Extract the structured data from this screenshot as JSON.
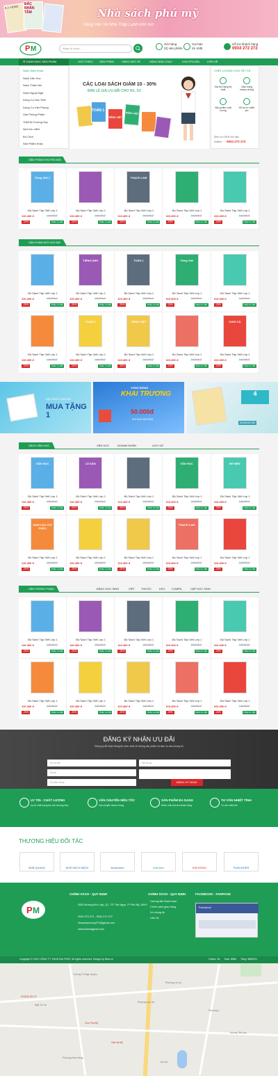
{
  "banner": {
    "title": "Nhà sách phú mỹ",
    "subtitle": "Hãng Ven Và Nhà Thập Lạnh ước mơ",
    "book1": "A.J. HOGE",
    "book2": "ĐẮC NHÂN TÂM"
  },
  "header": {
    "search_placeholder": "Nhập từ khóa...",
    "cart_label1": "Giỏ hàng",
    "cart_label2": "(0) sản phẩm",
    "call_label1": "Gọi bán",
    "call_label2": "tới nhất",
    "support_label": "Hỗ trợ khách hàng",
    "hotline": "0934 272 272"
  },
  "nav": {
    "category_label": "DANH MỤC SẢN PHẨM",
    "items": [
      "GIỚI THIỆU",
      "SẢN PHẨM",
      "HÀNG MỚI VỀ",
      "HÀNG BÁN CHẠY",
      "KHUYẾN MÃI",
      "LIÊN HỆ"
    ]
  },
  "sidebar": {
    "items": [
      "Sách Giáo Khoa",
      "Sách Văn Học",
      "Sách Thiếu Nhi",
      "Sách Ngoại Ngữ",
      "Dụng Cụ Học Sinh",
      "Dụng Cụ Văn Phòng",
      "Văn Phòng Phẩm",
      "Thiết Bị Trường Học",
      "Quà lưu niệm",
      "Đồ Chơi",
      "Sản Phẩm Khác"
    ]
  },
  "hero": {
    "line1": "CÁC LOẠI SÁCH GIẢM 10 - 30%",
    "line2": "BÁN LẺ GIÁ ƯU ĐÃI CHO HS, SV",
    "book1": "TOÁN 1",
    "book2": "TIẾNG VIỆT",
    "book3": "TIẾNG VIỆT"
  },
  "rightpanel": {
    "title": "CHẤT LƯỢNG CHO TẤT CẢ",
    "features": [
      "Giá tốt Hàng tốt nhất",
      "Giao hàng nhanh chóng",
      "Sản phẩm chất lượng",
      "Hỗ trợ tư miễn phí"
    ],
    "service_line": "Dịch vụ CSKH chu đáo",
    "hotline_label": "Hotline:",
    "hotline": "0934 272 272"
  },
  "product": {
    "name": "Bộ Sách Tập Viết Lớp 1",
    "price": "110.400 đ",
    "old_price": "149.000 đ",
    "discount": "-20%",
    "button": "Nhận ưu đãi"
  },
  "sections": {
    "promo": {
      "title": "SẢN PHẨM KHUYẾN MÃI"
    },
    "featured": {
      "title": "SẢN PHẨM MỚI NỔI BẬT"
    },
    "literature": {
      "title": "SÁCH VĂN HỌC",
      "subs": [
        "VĂN HỌC",
        "DOANH NHÂN",
        "LỊCH SỬ"
      ]
    },
    "stationery": {
      "title": "VĂN PHÒNG PHẨM",
      "subs": [
        "BẢNG HỌC SINH",
        "VIẾT",
        "THƯỚC",
        "KEO",
        "COMPA",
        "CẶP HỌC SINH"
      ]
    }
  },
  "cover_titles": {
    "promo": [
      "Tiếng Việt 1",
      "",
      "THẠCH LAM",
      "",
      ""
    ],
    "featured": [
      "",
      "TIẾNG ANH",
      "TOÁN 1",
      "Tiếng Việt",
      "",
      "",
      "TOÁN 1",
      "TIẾNG VIỆT",
      "",
      "CHƠI CẢ"
    ],
    "literature": [
      "VĂN HỌC",
      "LÃ SẢN",
      "",
      "VĂN HỌC",
      "ĐỂ MÈN",
      "NAM CAO CHÍ PHÈO",
      "",
      "",
      "THẠCH LAM",
      ""
    ]
  },
  "promo_banners": {
    "b1_text": "HỘI SÁCH QUÀ BA",
    "b1_big": "MUA TẶNG 1",
    "b2_top": "TƯNG BỪNG",
    "b2_big": "KHAI TRƯƠNG",
    "b2_amount": "50.000đ",
    "b2_note": "KHI MUA 200.000đ",
    "b3_phone": "08.66911789"
  },
  "newsletter": {
    "title": "ĐĂNG KÝ NHẬN ƯU ĐÃI",
    "desc": "Đăng ký để nhận thông tin sớm nhất về những sản phẩm và dịch vụ của chúng tôi",
    "name_placeholder": "Họ và tên",
    "phone_placeholder": "Số điện thoại",
    "email_placeholder": "Email",
    "note_placeholder": "Nội dung",
    "button": "ĐĂNG KÝ NGAY"
  },
  "features": [
    {
      "title": "UY TÍN - CHẤT LƯỢNG",
      "desc": "Uy tín chất lượng tạo nên thương hiệu"
    },
    {
      "title": "VẬN CHUYỂN SIÊU TỐC",
      "desc": "Vận chuyển nhanh chóng"
    },
    {
      "title": "SẢN PHẨM ĐA DẠNG",
      "desc": "Nhiều mẫu mã cho khách hàng"
    },
    {
      "title": "TƯ VẤN NHIỆT TÌNH",
      "desc": "Tư vấn nhiệt tình"
    }
  ],
  "partners": {
    "title": "THƯƠNG HIỆU ĐỐI TÁC",
    "logos": [
      "NHÃ QUANG",
      "NHÃ SÁCH BÁCH",
      "Bookdome",
      "nhã nam",
      "KIM ĐỒNG",
      "PUBLISHER"
    ]
  },
  "footer": {
    "col1_title": "CHÍNH SÁCH - QUY ĐỊNH",
    "address": "2050 Đường Đức Lập, Q1, TP. Tân Ngọc, P. Phú Mỹ, 08VV",
    "phone": "0934 272 272 - 0934 272 272",
    "email": "nhasachphumy272@gmail.com",
    "website": "www.kimlongphat.com",
    "col2_title": "CHÍNH SÁCH - QUY ĐỊNH",
    "col2_items": [
      "Hướng dẫn thanh toán",
      "Chính sách giao hàng",
      "Về chúng tôi",
      "Liên hệ"
    ],
    "col3_title": "FACEBOOK - FANPAGE",
    "fb_name": "Facebook"
  },
  "bottombar": {
    "copyright": "Copyright © 2021 CÔNG TY TNHH ĐẠI PHÁT. All rights reserved. Design by Nina.vn",
    "online": "Online: 08",
    "today": "Tuần: 8566",
    "total": "Tổng: 9865231"
  },
  "map": {
    "labels": [
      "Trường TH Ngô Quyền",
      "Phường Lê Lợi",
      "Ngã Tư Hà",
      "Chợ Phú Mỹ",
      "Phường 4",
      "Giải Hà Mỹ",
      "Trường Tiểu học",
      "Phường Lộc Hà",
      "HOÀNG BÌ CƠ",
      "Lộc Hà",
      "Phường Nam Hồng"
    ]
  },
  "colors": {
    "primary": "#1f9d55",
    "accent": "#d62828",
    "dark": "#3f3f3f"
  }
}
